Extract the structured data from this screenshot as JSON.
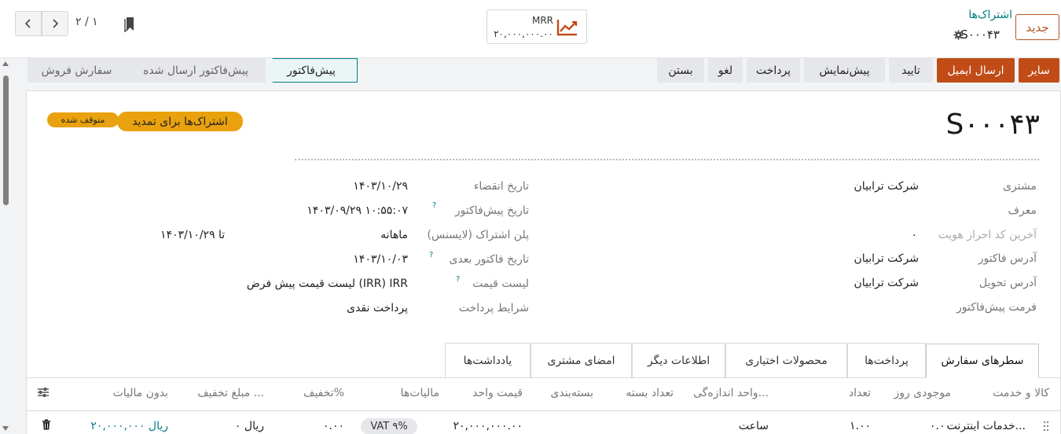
{
  "pager": {
    "text": "۲ / ۱"
  },
  "mrr": {
    "label": "MRR",
    "value": "۲۰,۰۰۰,۰۰۰.۰۰"
  },
  "header": {
    "breadcrumb": "اشتراک‌ها",
    "record_name": "S۰۰۰۴۳",
    "new_label": "جدید"
  },
  "actions": {
    "other": "سایر",
    "send_email": "ارسال ایمیل",
    "confirm": "تایید",
    "preview": "پیش‌نمایش",
    "payment": "پرداخت",
    "cancel": "لغو",
    "close": "بستن"
  },
  "status": {
    "quotation": "پیش‌فاکتور",
    "quotation_sent": "پیش‌فاکتور ارسال شده",
    "sale_order": "سفارش فروش"
  },
  "badges": {
    "renew": "اشتراک‌ها برای تمدید",
    "paused": "متوقف شده"
  },
  "title": "S۰۰۰۴۳",
  "left_fields": {
    "customer": {
      "label": "مشتری",
      "value": "شرکت ترابیان"
    },
    "referrer": {
      "label": "معرف"
    },
    "last_id_code": {
      "label": "آخرین کد احراز هویت",
      "value": "۰"
    },
    "invoice_address": {
      "label": "آدرس فاکتور",
      "value": "شرکت ترابیان"
    },
    "delivery_address": {
      "label": "آدرس تحویل",
      "value": "شرکت ترابیان"
    },
    "quote_format": {
      "label": "فرمت پیش‌فاکتور"
    }
  },
  "right_fields": {
    "expiration": {
      "label": "تاریخ انقضاء",
      "value": "۱۴۰۳/۱۰/۲۹"
    },
    "quote_date": {
      "label": "تاریخ پیش‌فاکتور",
      "value": "۱۴۰۳/۰۹/۲۹ ۱۰:۵۵:۰۷"
    },
    "plan": {
      "label": "پلن اشتراک (لایسنس)",
      "value": "ماهانه",
      "until": "تا ۱۴۰۳/۱۰/۲۹"
    },
    "next_invoice": {
      "label": "تاریخ فاکتور بعدی",
      "value": "۱۴۰۳/۱۰/۰۳"
    },
    "pricelist": {
      "label": "لیست قیمت",
      "value": "لیست قیمت پیش فرض (IRR) IRR"
    },
    "payment_terms": {
      "label": "شرایط پرداخت",
      "value": "پرداخت نقدی"
    }
  },
  "help_mark": "?",
  "tabs": [
    "سطرهای سفارش",
    "پرداخت‌ها",
    "محصولات اختیاری",
    "اطلاعات دیگر",
    "امضای مشتری",
    "یادداشت‌ها"
  ],
  "table": {
    "headers": [
      "کالا و خدمت",
      "موجودی روز",
      "تعداد",
      "واحد اندازه‌گی...",
      "تعداد بسته",
      "بسته‌بندی",
      "قیمت واحد",
      "مالیات‌ها",
      "تخفیف%",
      "مبلغ تخفیف ...",
      "بدون مالیات"
    ],
    "row": {
      "product": "خدمات اینترنت...",
      "stock": "۰.۰۰",
      "qty": "۱.۰۰",
      "uom": "ساعت",
      "unit_price": "۲۰,۰۰۰,۰۰۰.۰۰",
      "tax": "VAT ۹%",
      "discount": "۰.۰۰",
      "discount_amount": "ریال ۰",
      "subtotal": "ریال ۲۰,۰۰۰,۰۰۰"
    }
  },
  "colors": {
    "accent": "#c14c18",
    "teal": "#017e84",
    "badge": "#e9a10d"
  }
}
